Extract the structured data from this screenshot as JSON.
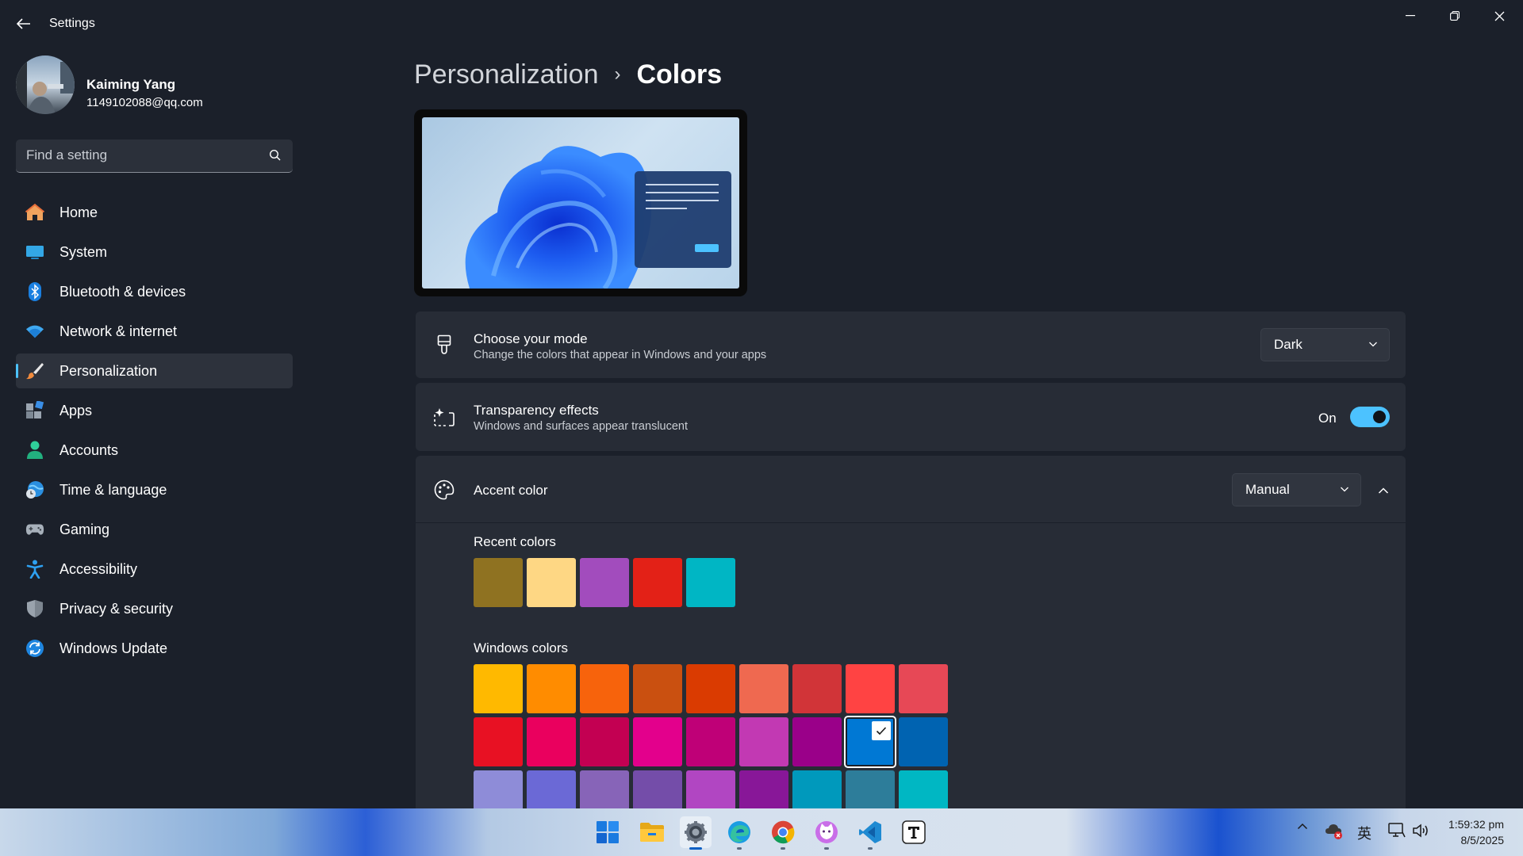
{
  "window": {
    "title": "Settings",
    "controls": [
      "minimize",
      "restore",
      "close"
    ]
  },
  "profile": {
    "name": "Kaiming Yang",
    "email": "1149102088@qq.com"
  },
  "search": {
    "placeholder": "Find a setting"
  },
  "nav": {
    "items": [
      {
        "label": "Home",
        "icon": "home-icon"
      },
      {
        "label": "System",
        "icon": "system-icon"
      },
      {
        "label": "Bluetooth & devices",
        "icon": "bluetooth-icon"
      },
      {
        "label": "Network & internet",
        "icon": "wifi-icon"
      },
      {
        "label": "Personalization",
        "icon": "brush-icon",
        "active": true
      },
      {
        "label": "Apps",
        "icon": "apps-icon"
      },
      {
        "label": "Accounts",
        "icon": "person-icon"
      },
      {
        "label": "Time & language",
        "icon": "globe-clock-icon"
      },
      {
        "label": "Gaming",
        "icon": "controller-icon"
      },
      {
        "label": "Accessibility",
        "icon": "accessibility-icon"
      },
      {
        "label": "Privacy & security",
        "icon": "shield-icon"
      },
      {
        "label": "Windows Update",
        "icon": "update-icon"
      }
    ]
  },
  "breadcrumb": {
    "parent": "Personalization",
    "separator": "›",
    "current": "Colors"
  },
  "mode": {
    "title": "Choose your mode",
    "subtitle": "Change the colors that appear in Windows and your apps",
    "value": "Dark"
  },
  "transparency": {
    "title": "Transparency effects",
    "subtitle": "Windows and surfaces appear translucent",
    "state_label": "On",
    "enabled": true
  },
  "accent": {
    "title": "Accent color",
    "value": "Manual",
    "recent_label": "Recent colors",
    "recent_colors": [
      "#8f7221",
      "#fed784",
      "#a24cbd",
      "#e32117",
      "#00b6c4"
    ],
    "windows_label": "Windows colors",
    "windows_colors": [
      [
        "#ffb900",
        "#ff8c00",
        "#f7630c",
        "#ca5010",
        "#da3b01",
        "#ef6950",
        "#d13438",
        "#ff4343",
        "#e74856"
      ],
      [
        "#e81123",
        "#ea005e",
        "#c30052",
        "#e3008c",
        "#bf0077",
        "#c239b3",
        "#9a0089",
        "#0078d4",
        "#0063b1"
      ],
      [
        "#8e8cd8",
        "#6b69d6",
        "#8764b8",
        "#744da9",
        "#b146c2",
        "#881798",
        "#0099bc",
        "#2d7d9a",
        "#00b7c3"
      ]
    ],
    "selected": {
      "row": 1,
      "col": 7
    }
  },
  "taskbar": {
    "apps": [
      "start-icon",
      "file-explorer-icon",
      "settings-icon",
      "edge-icon",
      "chrome-icon",
      "cat-app-icon",
      "vscode-icon",
      "typora-icon"
    ],
    "ime": "英",
    "time": "1:59:32 pm",
    "date": "8/5/2025"
  }
}
